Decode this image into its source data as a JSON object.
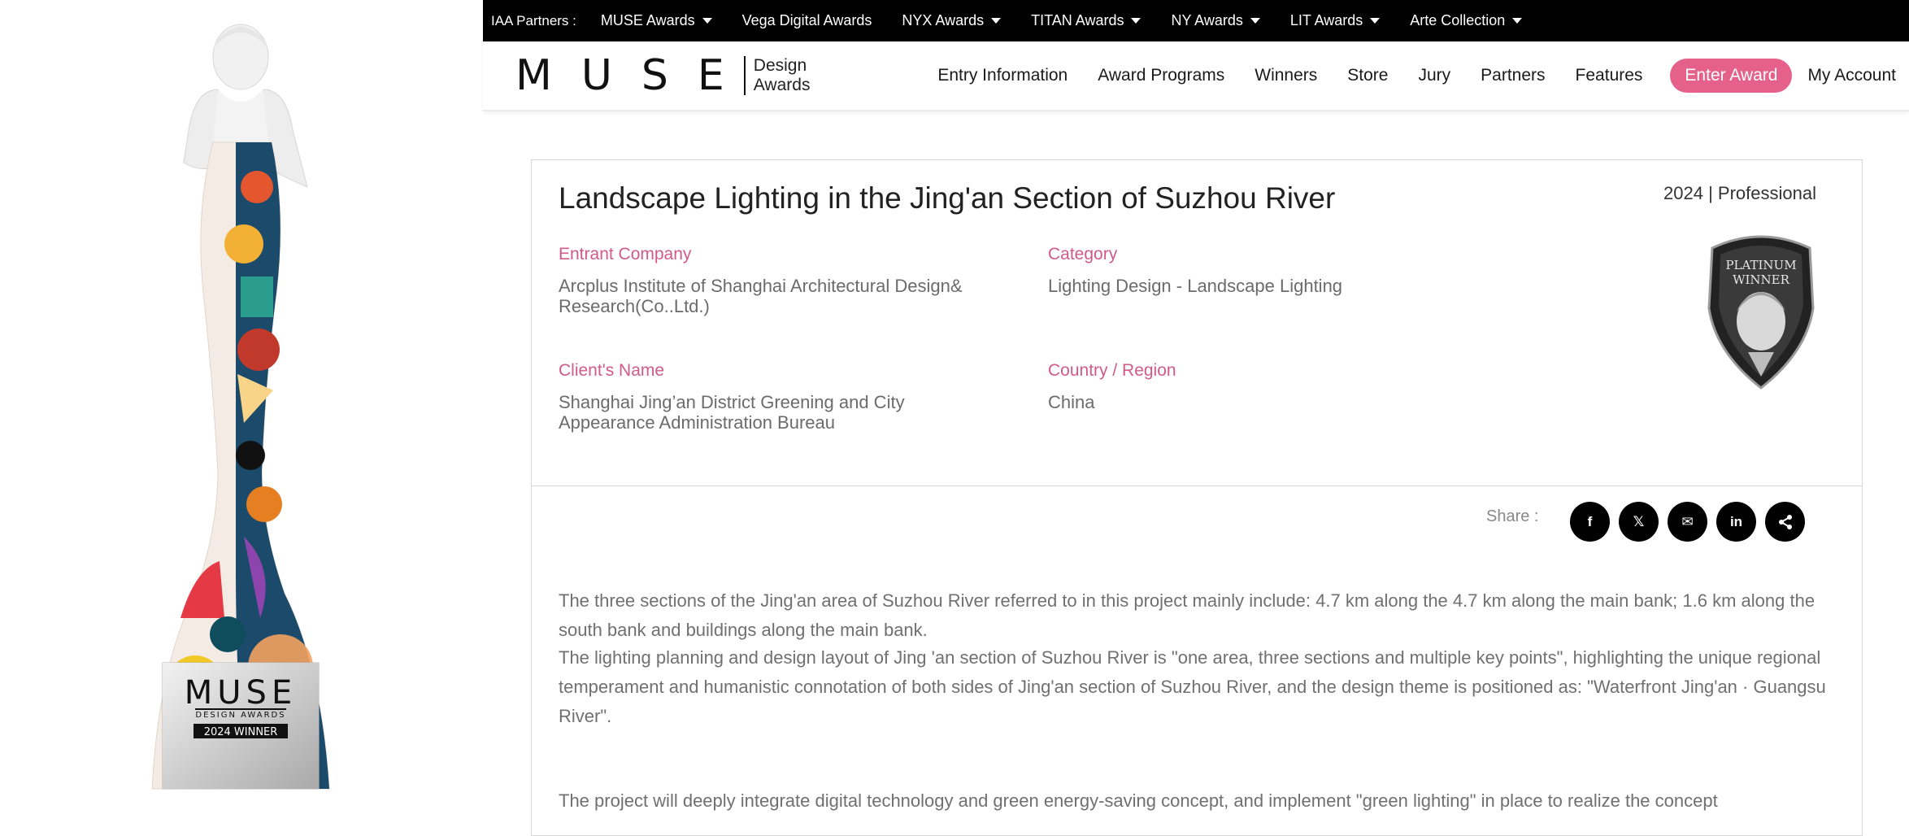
{
  "trophy": {
    "plate_brand": "MUSE",
    "plate_sub": "DESIGN AWARDS",
    "plate_badge": "2024 WINNER"
  },
  "partner_bar": {
    "label": "IAA Partners :",
    "items": [
      {
        "label": "MUSE Awards",
        "dropdown": true
      },
      {
        "label": "Vega Digital Awards",
        "dropdown": false
      },
      {
        "label": "NYX Awards",
        "dropdown": true
      },
      {
        "label": "TITAN Awards",
        "dropdown": true
      },
      {
        "label": "NY Awards",
        "dropdown": true
      },
      {
        "label": "LIT Awards",
        "dropdown": true
      },
      {
        "label": "Arte Collection",
        "dropdown": true
      }
    ]
  },
  "header": {
    "logo_text": "MUSE",
    "logo_sub_line1": "Design",
    "logo_sub_line2": "Awards",
    "nav": [
      "Entry Information",
      "Award Programs",
      "Winners",
      "Store",
      "Jury",
      "Partners",
      "Features"
    ],
    "enter_award": "Enter Award",
    "my_account": "My Account"
  },
  "project": {
    "title": "Landscape Lighting in the Jing'an Section of Suzhou River",
    "year_category": "2024 | Professional",
    "entrant_label": "Entrant Company",
    "entrant_value": "Arcplus Institute of Shanghai Architectural Design& Research(Co..Ltd.)",
    "category_label": "Category",
    "category_value": "Lighting Design - Landscape Lighting",
    "client_label": "Client's Name",
    "client_value": "Shanghai Jing’an District Greening and City Appearance Administration Bureau",
    "country_label": "Country / Region",
    "country_value": "China",
    "badge_line1": "PLATINUM",
    "badge_line2": "WINNER"
  },
  "share": {
    "label": "Share :",
    "buttons": [
      {
        "name": "facebook",
        "glyph": "f"
      },
      {
        "name": "x",
        "glyph": "𝕏"
      },
      {
        "name": "email",
        "glyph": "✉"
      },
      {
        "name": "linkedin",
        "glyph": "in"
      },
      {
        "name": "share",
        "glyph": "<"
      }
    ]
  },
  "description": [
    "The three sections of the Jing'an area of Suzhou River referred to in this project mainly include: 4.7 km along the 4.7 km along the main bank; 1.6 km along the south bank and buildings along the main bank.",
    "The lighting planning and design layout of Jing 'an section of Suzhou River is \"one area, three sections and multiple key points\", highlighting the unique regional temperament and humanistic connotation of both sides of Jing'an section of Suzhou River, and the design theme is positioned as: \"Waterfront Jing'an · Guangsu River\".",
    "The project will deeply integrate digital technology and green energy-saving concept, and implement \"green lighting\" in place to realize the concept"
  ],
  "colors": {
    "accent": "#e5608b",
    "label_pink": "#d05a88",
    "topbar": "#000000"
  }
}
